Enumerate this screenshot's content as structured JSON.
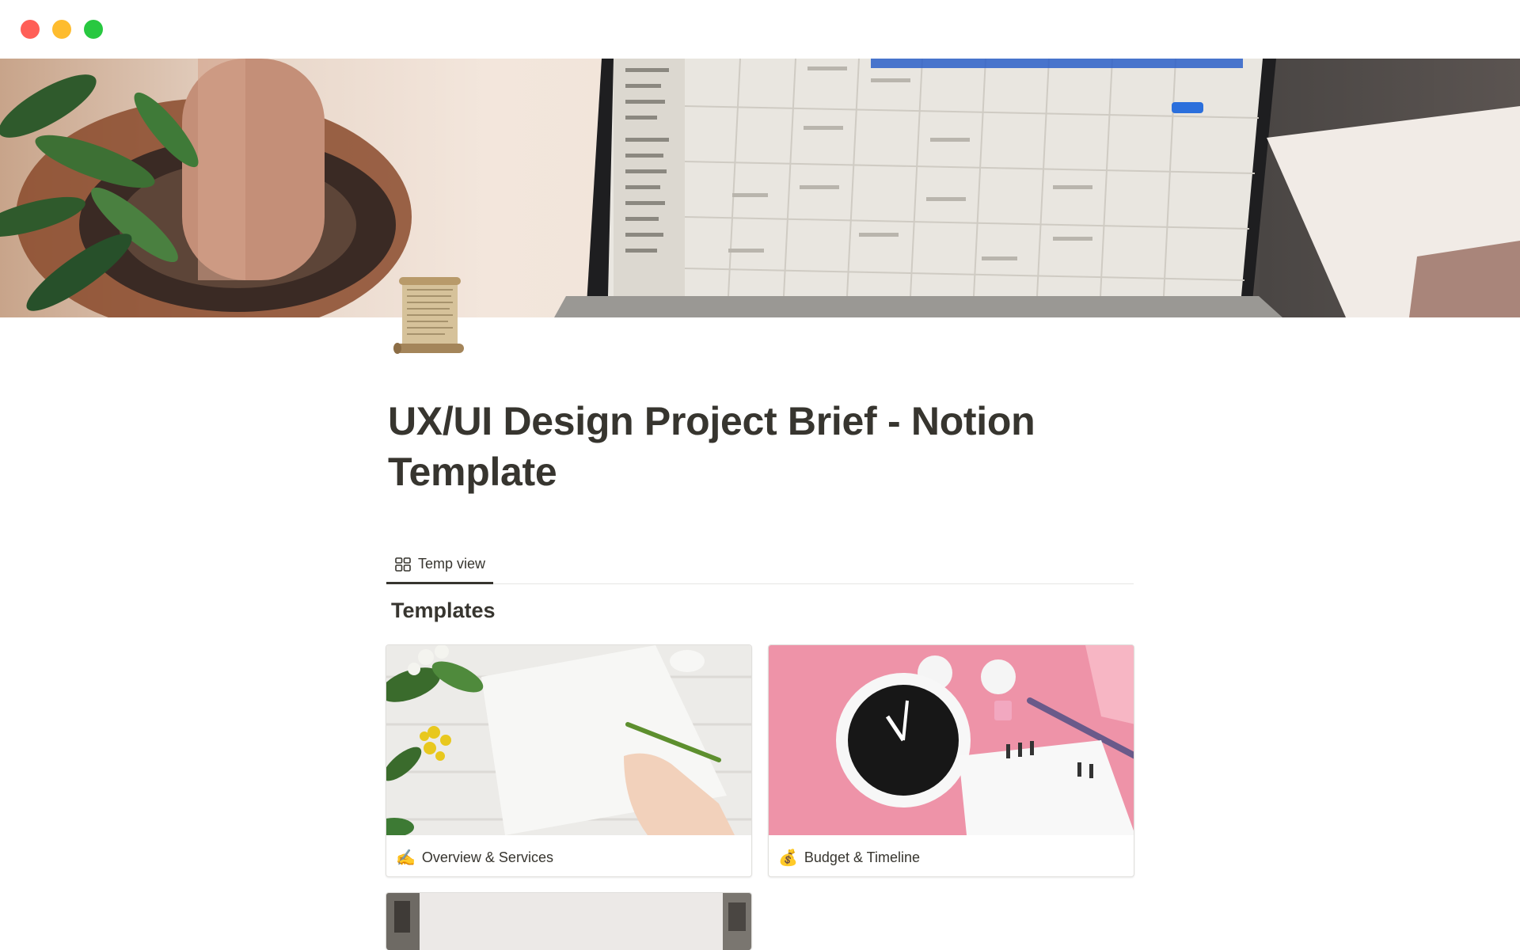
{
  "window": {
    "controls": [
      "close",
      "minimize",
      "zoom"
    ]
  },
  "cover": {
    "image": "desk-laptop-calendar-photo"
  },
  "page": {
    "icon": "scroll-icon",
    "title": "UX/UI Design Project Brief - Notion Template"
  },
  "views": {
    "tabs": [
      {
        "label": "Temp view",
        "icon": "gallery-icon",
        "active": true
      }
    ]
  },
  "gallery": {
    "heading": "Templates",
    "cards": [
      {
        "emoji": "✍️",
        "label": "Overview & Services",
        "cover": "hand-writing-on-paper-photo"
      },
      {
        "emoji": "💰",
        "label": "Budget & Timeline",
        "cover": "alarm-clock-calendar-photo"
      },
      {
        "emoji": "",
        "label": "",
        "cover": "partial-card-photo"
      }
    ]
  },
  "colors": {
    "text": "#37352f",
    "divider": "#e6e6e4",
    "close": "#ff5f57",
    "minimize": "#febc2e",
    "zoom": "#28c840"
  }
}
